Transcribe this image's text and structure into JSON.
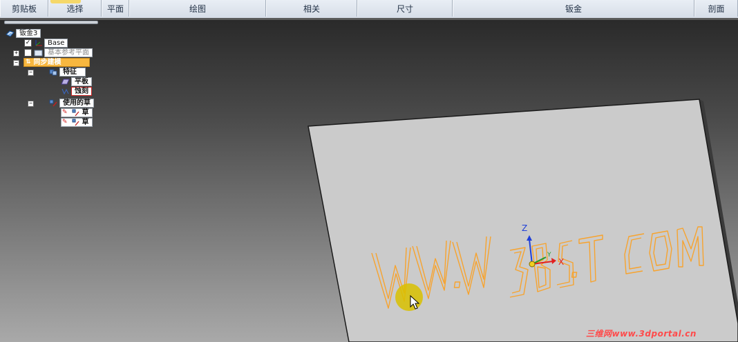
{
  "ribbon": {
    "groups": [
      {
        "label": "剪贴板"
      },
      {
        "label": "选择"
      },
      {
        "label": "平面"
      },
      {
        "label": "绘图"
      },
      {
        "label": "相关"
      },
      {
        "label": "尺寸"
      },
      {
        "label": "钣金"
      },
      {
        "label": "剖面"
      }
    ]
  },
  "tree": {
    "root": "钣金3",
    "base": "Base",
    "ref_planes": "基本参考平面",
    "sync": "同步建模",
    "features": "特征",
    "plate": "平板",
    "etch": "蚀刻",
    "used_sketches": "使用的草",
    "sketch1": "草",
    "sketch2": "草"
  },
  "model": {
    "etched_text": "WWW.3BST.COM",
    "axis_z": "Z",
    "axis_x": "X",
    "axis_y": "Y"
  },
  "watermark": "三维网www.3dportal.cn",
  "colors": {
    "etch": "#f7a32e",
    "plate": "#cbcbcb",
    "accent": "#f7b73f"
  }
}
